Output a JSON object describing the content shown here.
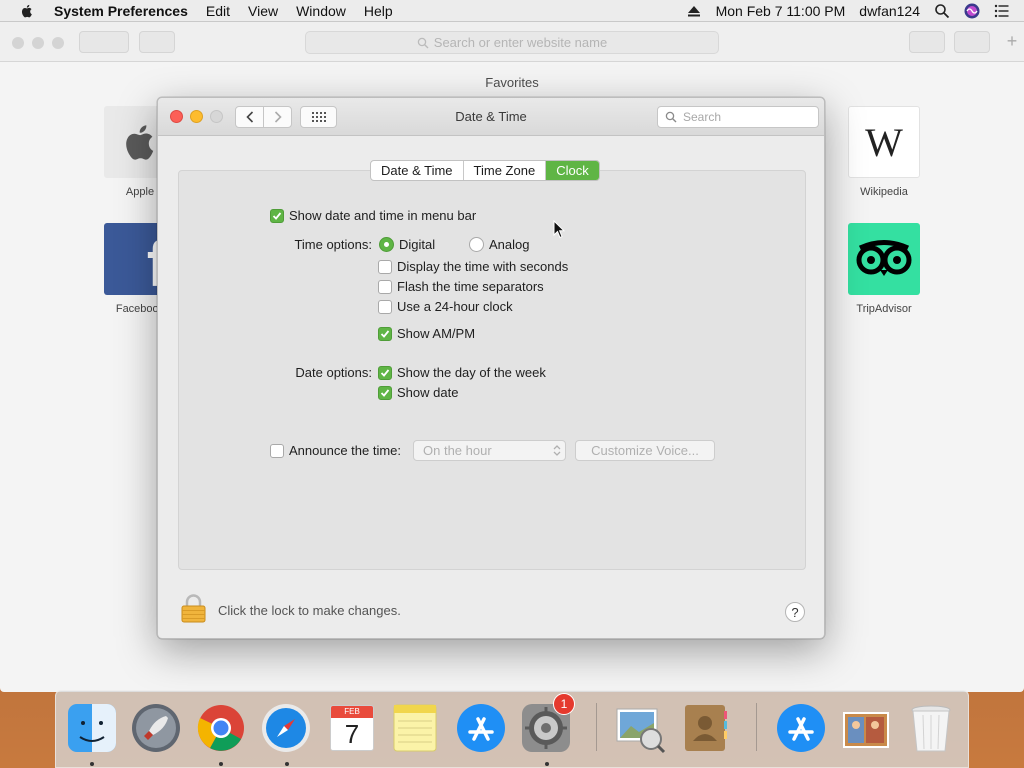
{
  "menubar": {
    "app_name": "System Preferences",
    "menus": [
      "Edit",
      "View",
      "Window",
      "Help"
    ],
    "datetime": "Mon Feb 7  11:00 PM",
    "user": "dwfan124",
    "icons": [
      "apple-icon",
      "eject-icon",
      "spotlight-search-icon",
      "siri-icon",
      "notification-center-icon"
    ]
  },
  "safari": {
    "address_placeholder": "Search or enter website name",
    "favorites_title": "Favorites",
    "favorites": [
      {
        "label": "Apple",
        "color": "#eaeaea"
      },
      {
        "label": "Wikipedia",
        "tile_text": "W",
        "color": "#ffffff"
      },
      {
        "label": "Facebook",
        "tile_text": "f",
        "color": "#3b5998"
      },
      {
        "label": "TripAdvisor",
        "color": "#34e0a1"
      }
    ]
  },
  "prefs": {
    "window_title": "Date & Time",
    "search_placeholder": "Search",
    "tabs": [
      {
        "label": "Date & Time",
        "active": false
      },
      {
        "label": "Time Zone",
        "active": false
      },
      {
        "label": "Clock",
        "active": true
      }
    ],
    "show_in_menubar": {
      "label": "Show date and time in menu bar",
      "checked": true
    },
    "time_options": {
      "label": "Time options:",
      "digital": {
        "label": "Digital",
        "selected": true
      },
      "analog": {
        "label": "Analog",
        "selected": false
      },
      "seconds": {
        "label": "Display the time with seconds",
        "checked": false
      },
      "flash": {
        "label": "Flash the time separators",
        "checked": false
      },
      "h24": {
        "label": "Use a 24-hour clock",
        "checked": false
      },
      "ampm": {
        "label": "Show AM/PM",
        "checked": true
      }
    },
    "date_options": {
      "label": "Date options:",
      "day_of_week": {
        "label": "Show the day of the week",
        "checked": true
      },
      "show_date": {
        "label": "Show date",
        "checked": true
      }
    },
    "announce": {
      "label": "Announce the time:",
      "checked": false,
      "interval": "On the hour",
      "voice_button": "Customize Voice..."
    },
    "lock_text": "Click the lock to make changes.",
    "help": "?"
  },
  "dock": {
    "apps": [
      {
        "name": "Finder",
        "running": true
      },
      {
        "name": "Launchpad",
        "running": false
      },
      {
        "name": "Google Chrome",
        "running": true
      },
      {
        "name": "Safari",
        "running": true
      },
      {
        "name": "Calendar",
        "running": false,
        "month": "FEB",
        "day": "7"
      },
      {
        "name": "Notes",
        "running": false
      },
      {
        "name": "App Store",
        "running": false
      },
      {
        "name": "System Preferences",
        "running": true,
        "badge": "1"
      },
      {
        "name": "Preview",
        "running": false
      },
      {
        "name": "Contacts",
        "running": false
      },
      {
        "name": "App Store Downloads",
        "running": false
      },
      {
        "name": "Photos Stack",
        "running": false
      },
      {
        "name": "Trash",
        "running": false
      }
    ]
  },
  "colors": {
    "accent_green": "#5fb545",
    "close_red": "#fc5f57",
    "minimize_yellow": "#fdbc2e",
    "badge_red": "#e53a2e"
  }
}
